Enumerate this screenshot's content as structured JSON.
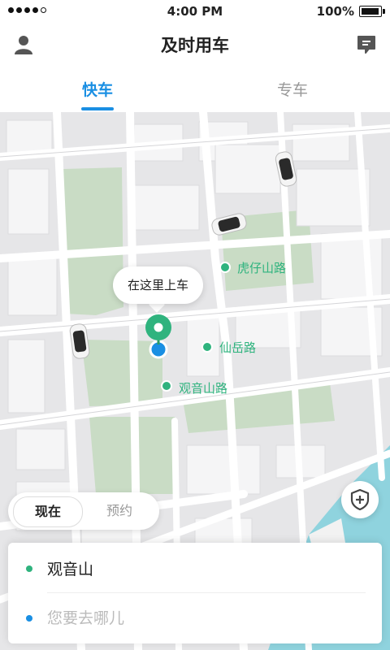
{
  "status_bar": {
    "time": "4:00 PM",
    "battery": "100%"
  },
  "header": {
    "title": "及时用车",
    "user_icon": "user-icon",
    "message_icon": "message-icon"
  },
  "tabs": [
    {
      "label": "快车",
      "active": true
    },
    {
      "label": "专车",
      "active": false
    }
  ],
  "map": {
    "pickup_callout": "在这里上车",
    "road_labels": [
      "虎仔山路",
      "仙岳路",
      "观音山路"
    ]
  },
  "time_mode": {
    "now": "现在",
    "later": "预约",
    "selected": "现在"
  },
  "trip": {
    "origin": "观音山",
    "destination_placeholder": "您要去哪儿"
  },
  "colors": {
    "accent": "#1a8fe3",
    "green": "#2fb37e",
    "water": "#8fd3de"
  }
}
